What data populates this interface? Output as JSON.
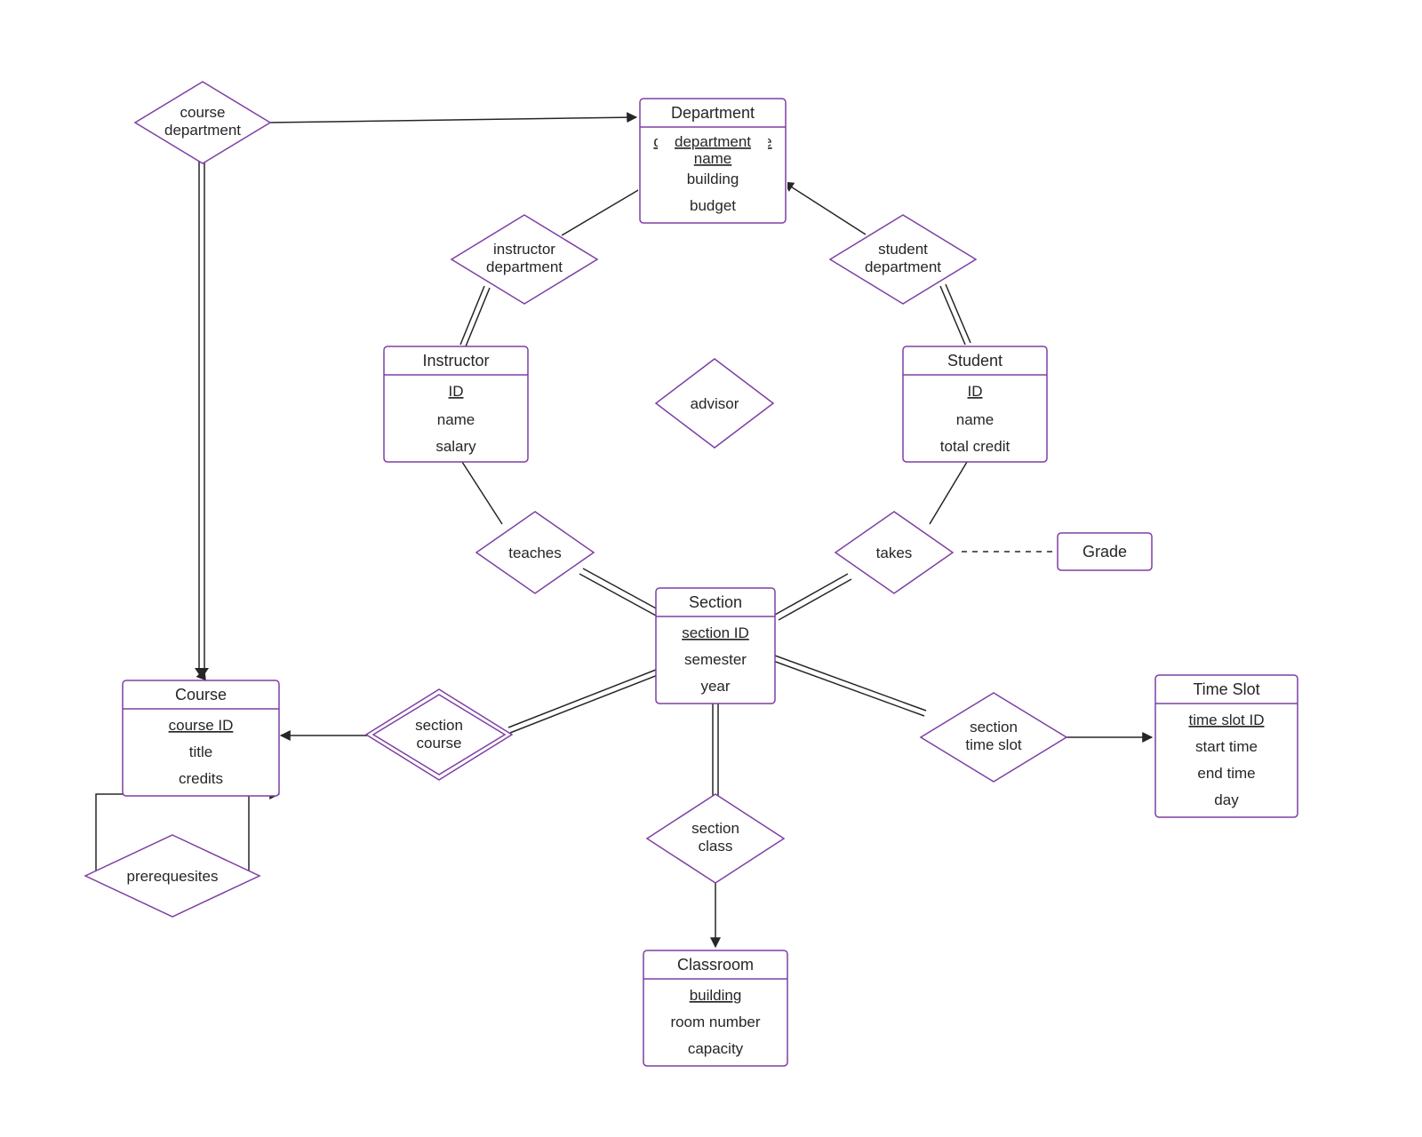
{
  "entities": {
    "department": {
      "title": "Department",
      "attrs": [
        "department name",
        "building",
        "budget"
      ],
      "key_index": 0
    },
    "instructor": {
      "title": "Instructor",
      "attrs": [
        "ID",
        "name",
        "salary"
      ],
      "key_index": 0
    },
    "student": {
      "title": "Student",
      "attrs": [
        "ID",
        "name",
        "total credit"
      ],
      "key_index": 0
    },
    "course": {
      "title": "Course",
      "attrs": [
        "course ID",
        "title",
        "credits"
      ],
      "key_index": 0
    },
    "section": {
      "title": "Section",
      "attrs": [
        "section ID",
        "semester",
        "year"
      ],
      "key_index": 0
    },
    "timeslot": {
      "title": "Time Slot",
      "attrs": [
        "time slot ID",
        "start time",
        "end time",
        "day"
      ],
      "key_index": 0
    },
    "classroom": {
      "title": "Classroom",
      "attrs": [
        "building",
        "room number",
        "capacity"
      ],
      "key_index": 0
    },
    "grade": {
      "title": "Grade"
    }
  },
  "relationships": {
    "course_department": {
      "label1": "course",
      "label2": "department"
    },
    "instructor_department": {
      "label1": "instructor",
      "label2": "department"
    },
    "student_department": {
      "label1": "student",
      "label2": "department"
    },
    "advisor": {
      "label1": "advisor"
    },
    "teaches": {
      "label1": "teaches"
    },
    "takes": {
      "label1": "takes"
    },
    "section_course": {
      "label1": "section",
      "label2": "course"
    },
    "section_class": {
      "label1": "section",
      "label2": "class"
    },
    "section_timeslot": {
      "label1": "section",
      "label2": "time slot"
    },
    "prerequisites": {
      "label1": "prerequesites"
    }
  }
}
